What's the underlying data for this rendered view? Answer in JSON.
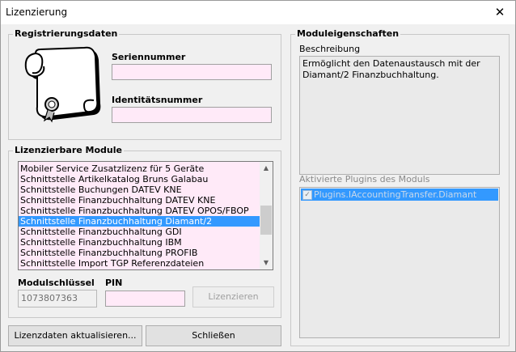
{
  "window": {
    "title": "Lizenzierung",
    "close_symbol": "✕"
  },
  "registration": {
    "group_label": "Registrierungsdaten",
    "serial_label": "Seriennummer",
    "serial_value": "",
    "identity_label": "Identitätsnummer",
    "identity_value": ""
  },
  "modules": {
    "group_label": "Lizenzierbare Module",
    "items": [
      "Mobiler Service Zusatzlizenz für 5 Geräte",
      "Schnittstelle Artikelkatalog Bruns Galabau",
      "Schnittstelle Buchungen DATEV KNE",
      "Schnittstelle Finanzbuchhaltung DATEV KNE",
      "Schnittstelle Finanzbuchhaltung DATEV OPOS/FBOP",
      "Schnittstelle Finanzbuchhaltung Diamant/2",
      "Schnittstelle Finanzbuchhaltung GDI",
      "Schnittstelle Finanzbuchhaltung IBM",
      "Schnittstelle Finanzbuchhaltung PROFIB",
      "Schnittstelle Import TGP Referenzdateien"
    ],
    "selected_index": 5,
    "module_key_label": "Modulschlüssel",
    "module_key_value": "1073807363",
    "pin_label": "PIN",
    "pin_value": "",
    "license_button": "Lizenzieren"
  },
  "properties": {
    "group_label": "Moduleigenschaften",
    "description_label": "Beschreibung",
    "description_text": "Ermöglicht den Datenaustausch mit der Diamant/2 Finanzbuchhaltung.",
    "plugins_label": "Aktivierte Plugins des Moduls",
    "plugins": [
      {
        "name": "Plugins.IAccountingTransfer.Diamant",
        "checked": true
      }
    ]
  },
  "footer": {
    "update_button": "Lizenzdaten aktualisieren...",
    "close_button": "Schließen"
  },
  "colors": {
    "selection": "#3399ff",
    "field_pink": "#ffeaf8",
    "dialog_bg": "#f0f0f0"
  }
}
